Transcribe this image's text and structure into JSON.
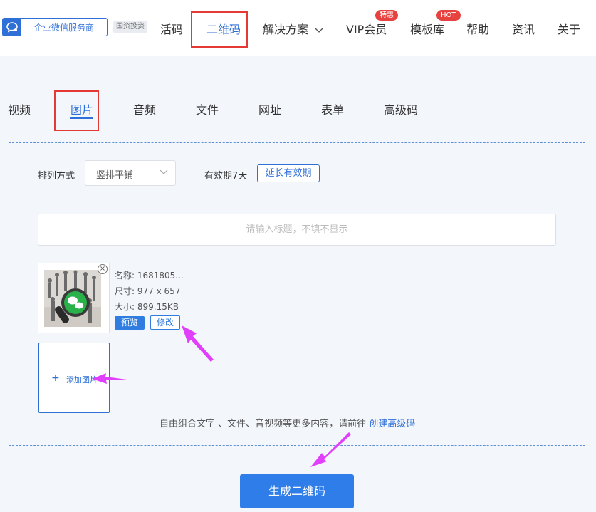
{
  "header": {
    "logo_text": "企业微信服务商",
    "invest_tag": "国资投资",
    "nav": {
      "huoma": "活码",
      "erweima": "二维码",
      "solutions": "解决方案",
      "vip": "VIP会员",
      "vip_badge": "特惠",
      "templates": "模板库",
      "templates_badge": "HOT",
      "help": "帮助",
      "news": "资讯",
      "about": "关于"
    }
  },
  "tabs": {
    "video": "视频",
    "image": "图片",
    "audio": "音频",
    "file": "文件",
    "url": "网址",
    "form": "表单",
    "advanced": "高级码"
  },
  "panel": {
    "arrange_label": "排列方式",
    "arrange_value": "竖排平铺",
    "validity_text": "有效期7天",
    "extend_button": "延长有效期",
    "title_placeholder": "请输入标题，不填不显示",
    "image": {
      "name": "名称: 1681805...",
      "size": "尺寸: 977 x 657",
      "filesize": "大小: 899.15KB",
      "preview_button": "预览",
      "edit_button": "修改"
    },
    "add_image_label": "添加图片",
    "hint_text": "自由组合文字 、文件、音视频等更多内容，请前往 ",
    "hint_link": "创建高级码"
  },
  "generate_button": "生成二维码",
  "colors": {
    "accent": "#2f6fd8",
    "highlight_box": "#e53935",
    "annotation_arrow": "#e040fb",
    "badge": "#e64340"
  }
}
